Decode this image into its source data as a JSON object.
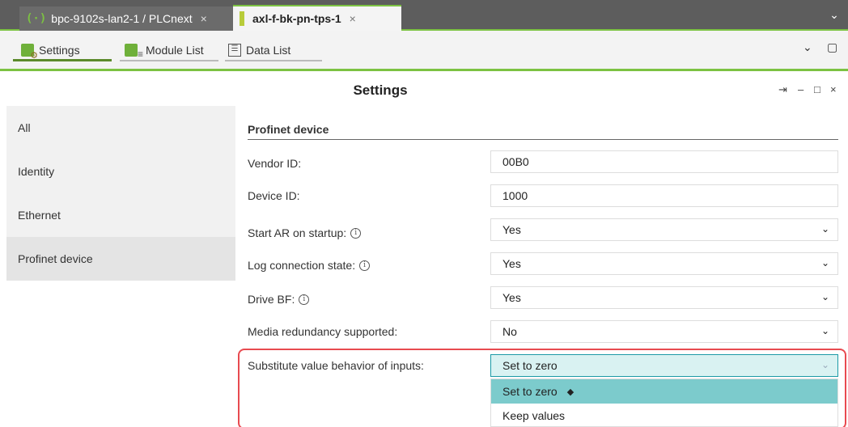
{
  "tabs": [
    {
      "icon": "plcnext-brackets-icon",
      "glyph": "(·)",
      "label": "bpc-9102s-lan2-1 / PLCnext",
      "close": "×"
    },
    {
      "icon": "device-bar-icon",
      "label": "axl-f-bk-pn-tps-1",
      "close": "×"
    }
  ],
  "tab_overflow": "⌄",
  "toolbar": {
    "tabs": [
      {
        "icon": "settings-icon",
        "label": "Settings"
      },
      {
        "icon": "module-list-icon",
        "label": "Module List"
      },
      {
        "icon": "data-list-icon",
        "glyph": "☰",
        "label": "Data List"
      }
    ],
    "collapse": "⌄",
    "restore": "▢"
  },
  "panel": {
    "title": "Settings",
    "pin": "⇥",
    "minimize": "–",
    "maximize": "□",
    "close": "×"
  },
  "sidebar": {
    "items": [
      "All",
      "Identity",
      "Ethernet",
      "Profinet device"
    ],
    "selected": "Profinet device"
  },
  "section": {
    "title": "Profinet device"
  },
  "info_glyph": "i",
  "rows": [
    {
      "label": "Vendor ID:",
      "value": "00B0",
      "type": "text",
      "info": false
    },
    {
      "label": "Device ID:",
      "value": "1000",
      "type": "text",
      "info": false
    },
    {
      "label": "Start AR on startup:",
      "value": "Yes",
      "type": "select",
      "info": true
    },
    {
      "label": "Log connection state:",
      "value": "Yes",
      "type": "select",
      "info": true
    },
    {
      "label": "Drive BF:",
      "value": "Yes",
      "type": "select",
      "info": true
    },
    {
      "label": "Media redundancy supported:",
      "value": "No",
      "type": "select",
      "info": false
    },
    {
      "label": "Substitute value behavior of inputs:",
      "value": "Set to zero",
      "type": "select",
      "info": false
    }
  ],
  "chevron": "⌄",
  "dropdown": {
    "options": [
      "Set to zero",
      "Keep values"
    ],
    "selected_marker": "◆"
  },
  "colors": {
    "accent_green": "#7cc242",
    "highlight_red": "#e84a50",
    "dropdown_selected": "#7ccbcc",
    "open_field_bg": "#d9f2f2"
  }
}
